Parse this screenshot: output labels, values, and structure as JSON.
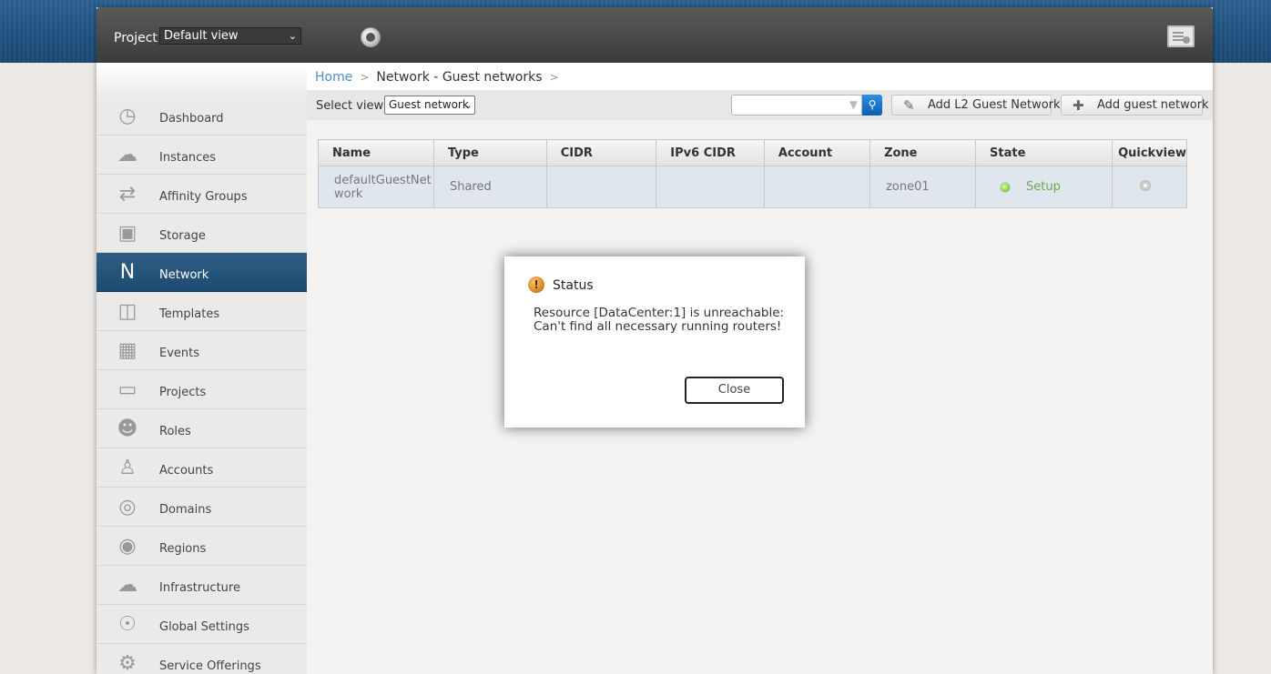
{
  "header": {
    "project_label": "Project",
    "project_selected": "Default view"
  },
  "sidebar": {
    "items": [
      {
        "label": "Dashboard",
        "icon": "dashboard-icon"
      },
      {
        "label": "Instances",
        "icon": "cloud-icon"
      },
      {
        "label": "Affinity Groups",
        "icon": "affinity-cloud-icon"
      },
      {
        "label": "Storage",
        "icon": "storage-icon"
      },
      {
        "label": "Network",
        "icon": "network-icon",
        "active": true
      },
      {
        "label": "Templates",
        "icon": "templates-icon"
      },
      {
        "label": "Events",
        "icon": "calendar-icon"
      },
      {
        "label": "Projects",
        "icon": "folder-icon"
      },
      {
        "label": "Roles",
        "icon": "roles-icon"
      },
      {
        "label": "Accounts",
        "icon": "user-icon"
      },
      {
        "label": "Domains",
        "icon": "domains-icon"
      },
      {
        "label": "Regions",
        "icon": "globe-icon"
      },
      {
        "label": "Infrastructure",
        "icon": "infrastructure-icon"
      },
      {
        "label": "Global Settings",
        "icon": "global-settings-icon"
      },
      {
        "label": "Service Offerings",
        "icon": "gear-icon"
      }
    ]
  },
  "breadcrumb": {
    "home": "Home",
    "separator": ">",
    "current": "Network - Guest networks"
  },
  "toolbar": {
    "select_view_label": "Select view:",
    "select_view_value": "Guest network",
    "add_l2_label": "Add L2 Guest Network",
    "add_guest_label": "Add guest network"
  },
  "table": {
    "columns": [
      "Name",
      "Type",
      "CIDR",
      "IPv6 CIDR",
      "Account",
      "Zone",
      "State",
      "Quickview"
    ],
    "rows": [
      {
        "name_line1": "defaultGuestNet",
        "name_line2": "work",
        "type": "Shared",
        "cidr": "",
        "ipv6_cidr": "",
        "account": "",
        "zone": "zone01",
        "state": "Setup"
      }
    ]
  },
  "dialog": {
    "title": "Status",
    "message_line1": "Resource [DataCenter:1] is unreachable:",
    "message_line2": "Can't find all necessary running routers!",
    "close_label": "Close"
  }
}
